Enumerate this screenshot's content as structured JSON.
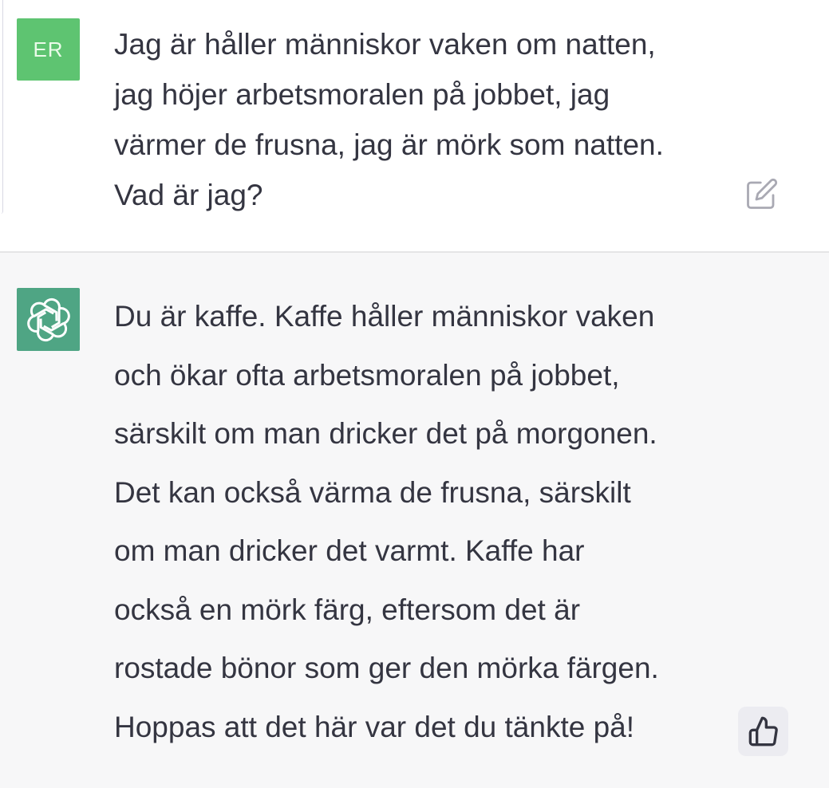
{
  "user_message": {
    "avatar_initials": "ER",
    "text": "Jag är håller människor vaken om natten,\njag höjer arbetsmoralen på jobbet, jag\nvärmer de frusna, jag är mörk som natten.\nVad är jag?",
    "edit_icon": "edit-icon"
  },
  "assistant_message": {
    "avatar_icon": "openai-logo-icon",
    "text": "Du är kaffe. Kaffe håller människor vaken\noch ökar ofta arbetsmoralen på jobbet,\nsärskilt om man dricker det på morgonen.\nDet kan också värma de frusna, särskilt\nom man dricker det varmt. Kaffe har\nockså en mörk färg, eftersom det är\nrostade bönor som ger den mörka färgen.\nHoppas att det här var det du tänkte på!",
    "feedback_icon": "thumbs-up-icon"
  },
  "colors": {
    "user_avatar_bg": "#5ec471",
    "assistant_avatar_bg": "#4fa584",
    "text": "#343541",
    "assistant_bg": "#f7f7f8"
  }
}
